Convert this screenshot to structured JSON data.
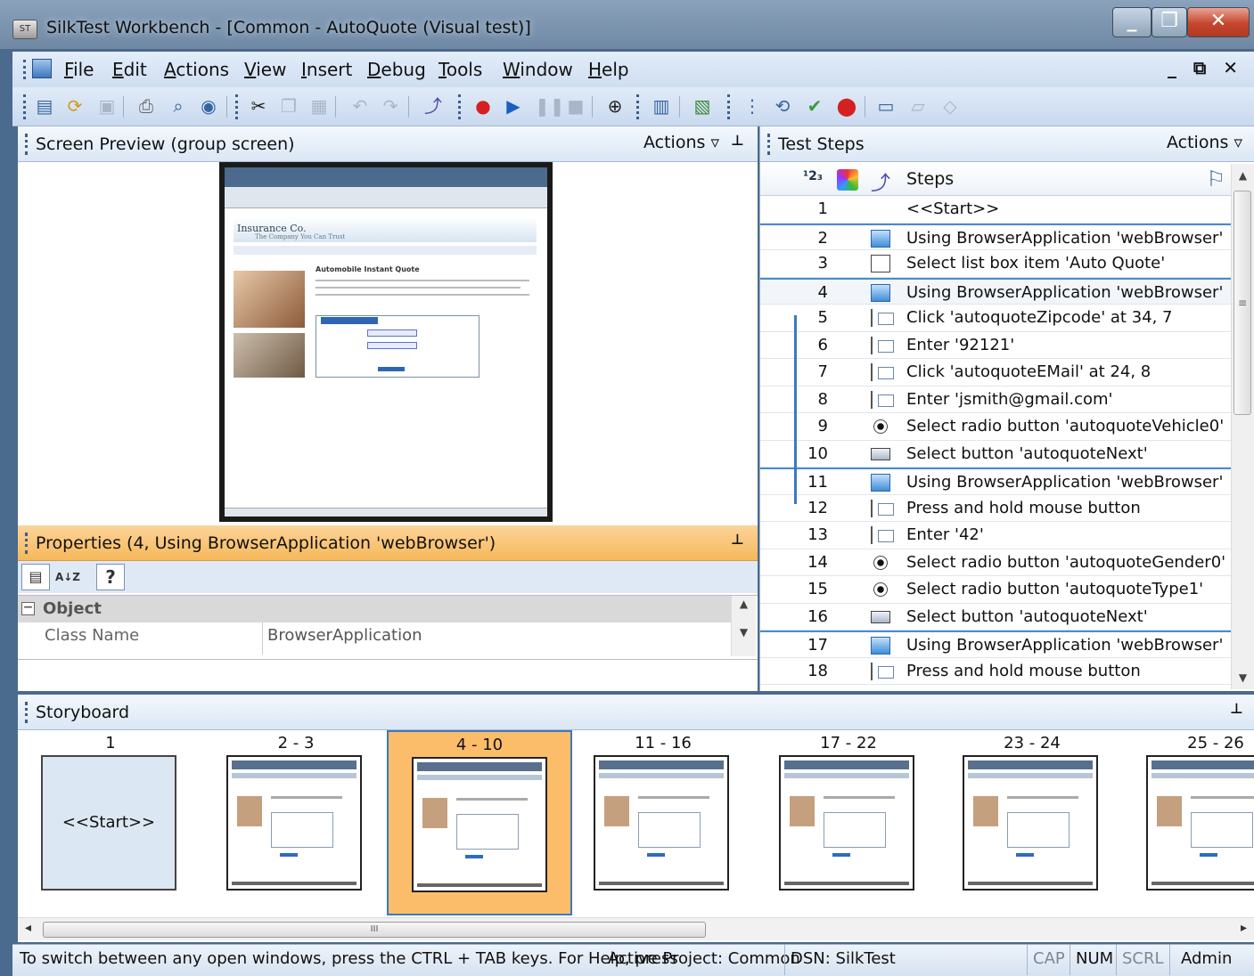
{
  "window": {
    "title": "SilkTest Workbench - [Common - AutoQuote (Visual test)]",
    "icon_label": "ST",
    "controls": [
      "_",
      "❐",
      "✕"
    ]
  },
  "menu": {
    "items": [
      "File",
      "Edit",
      "Actions",
      "View",
      "Insert",
      "Debug",
      "Tools",
      "Window",
      "Help"
    ],
    "mdi_controls": "_ ⧉ ✕"
  },
  "toolbar": {
    "icons": [
      "new-icon",
      "open-icon",
      "save-icon",
      "print-icon",
      "print-preview-icon",
      "help-icon",
      "cut-icon",
      "copy-icon",
      "paste-icon",
      "undo-icon",
      "redo-icon",
      "add-step-icon",
      "record-icon",
      "play-icon",
      "pause-icon",
      "stop-icon",
      "target-icon",
      "screen-icon",
      "properties-icon",
      "step-numbers-icon",
      "refresh-icon",
      "verify-icon",
      "remove-icon",
      "rectangle-icon",
      "parallelogram-icon",
      "diamond-icon"
    ]
  },
  "screen_preview": {
    "title": "Screen Preview (group screen)",
    "actions_label": "Actions ▿",
    "pin": "⊥"
  },
  "preview_page": {
    "company": "Insurance Co.",
    "tagline": "The Company You Can Trust",
    "heading": "Automobile Instant Quote"
  },
  "properties": {
    "title": "Properties (4, Using BrowserApplication 'webBrowser')",
    "pin": "⊥",
    "category": "Object",
    "category_toggle": "−",
    "rows": [
      {
        "name": "Class Name",
        "value": "BrowserApplication"
      }
    ],
    "help_glyph": "?",
    "sort_glyph": "A↓Z"
  },
  "test_steps": {
    "title": "Test Steps",
    "actions_label": "Actions ▿",
    "column_header": "Steps",
    "number_header": "¹2₃",
    "rows": [
      {
        "num": "1",
        "icon": "none",
        "text": "<<Start>>"
      },
      {
        "num": "2",
        "icon": "browser",
        "text": "Using BrowserApplication 'webBrowser'"
      },
      {
        "num": "3",
        "icon": "list",
        "text": "Select list box item 'Auto Quote'"
      },
      {
        "num": "4",
        "icon": "browser",
        "text": "Using BrowserApplication 'webBrowser'"
      },
      {
        "num": "5",
        "icon": "text",
        "text": "Click 'autoquoteZipcode' at 34, 7"
      },
      {
        "num": "6",
        "icon": "text",
        "text": "Enter '92121'"
      },
      {
        "num": "7",
        "icon": "text",
        "text": "Click 'autoquoteEMail' at 24, 8"
      },
      {
        "num": "8",
        "icon": "text",
        "text": "Enter 'jsmith@gmail.com'"
      },
      {
        "num": "9",
        "icon": "radio",
        "text": "Select radio button 'autoquoteVehicle0'"
      },
      {
        "num": "10",
        "icon": "button",
        "text": "Select button 'autoquoteNext'"
      },
      {
        "num": "11",
        "icon": "browser",
        "text": "Using BrowserApplication 'webBrowser'"
      },
      {
        "num": "12",
        "icon": "text",
        "text": "Press and hold mouse button"
      },
      {
        "num": "13",
        "icon": "text",
        "text": "Enter '42'"
      },
      {
        "num": "14",
        "icon": "radio",
        "text": "Select radio button 'autoquoteGender0'"
      },
      {
        "num": "15",
        "icon": "radio",
        "text": "Select radio button 'autoquoteType1'"
      },
      {
        "num": "16",
        "icon": "button",
        "text": "Select button 'autoquoteNext'"
      },
      {
        "num": "17",
        "icon": "browser",
        "text": "Using BrowserApplication 'webBrowser'"
      },
      {
        "num": "18",
        "icon": "text",
        "text": "Press and hold mouse button"
      }
    ]
  },
  "storyboard": {
    "title": "Storyboard",
    "pin": "⊥",
    "frames": [
      {
        "label": "1",
        "start_text": "<<Start>>"
      },
      {
        "label": "2 - 3"
      },
      {
        "label": "4 - 10",
        "selected": true
      },
      {
        "label": "11 - 16"
      },
      {
        "label": "17 - 22"
      },
      {
        "label": "23 - 24"
      },
      {
        "label": "25 - 26"
      }
    ],
    "scroll_grip": "III"
  },
  "status": {
    "hint": "To switch between any open windows, press the CTRL + TAB keys. For Help, press",
    "project": "Active Project: Common",
    "dsn": "DSN: SilkTest",
    "cap": "CAP",
    "num": "NUM",
    "scrl": "SCRL",
    "user": "Admin"
  },
  "colors": {
    "selection": "#fbbd6a",
    "accent": "#3d78c0",
    "properties_header": "#f6b85a"
  }
}
